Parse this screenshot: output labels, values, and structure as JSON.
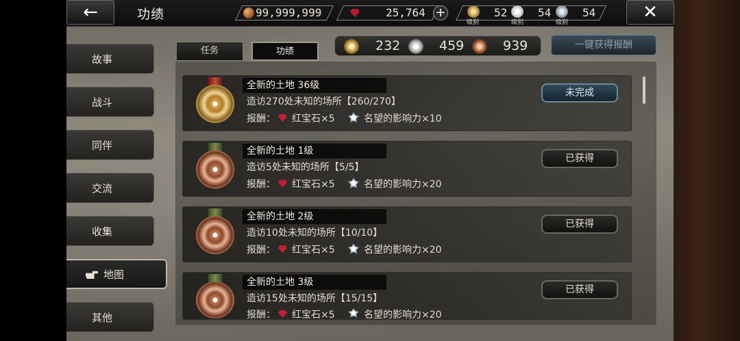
{
  "header": {
    "title": "功绩",
    "gold": "99,999,999",
    "rubies": "25,764",
    "level_label": "级别",
    "medal_levels": [
      "52",
      "54",
      "54"
    ]
  },
  "side_tabs": [
    "故事",
    "战斗",
    "同伴",
    "交流",
    "收集",
    "地图",
    "其他"
  ],
  "sub_tabs": [
    "任务",
    "功绩"
  ],
  "totals": [
    "232",
    "459",
    "939"
  ],
  "claim_all_label": "一键获得报酬",
  "achievements": [
    {
      "title": "全新的土地 36级",
      "desc": "造访270处未知的场所【260/270】",
      "reward_prefix": "报酬：",
      "ruby": "红宝石×5",
      "rep": "名望的影响力×10",
      "status": "未完成",
      "medal": "gold"
    },
    {
      "title": "全新的土地 1级",
      "desc": "造访5处未知的场所【5/5】",
      "reward_prefix": "报酬：",
      "ruby": "红宝石×5",
      "rep": "名望的影响力×20",
      "status": "已获得",
      "medal": "bronze"
    },
    {
      "title": "全新的土地 2级",
      "desc": "造访10处未知的场所【10/10】",
      "reward_prefix": "报酬：",
      "ruby": "红宝石×5",
      "rep": "名望的影响力×20",
      "status": "已获得",
      "medal": "bronze"
    },
    {
      "title": "全新的土地 3级",
      "desc": "造访15处未知的场所【15/15】",
      "reward_prefix": "报酬：",
      "ruby": "红宝石×5",
      "rep": "名望的影响力×20",
      "status": "已获得",
      "medal": "bronze"
    }
  ]
}
